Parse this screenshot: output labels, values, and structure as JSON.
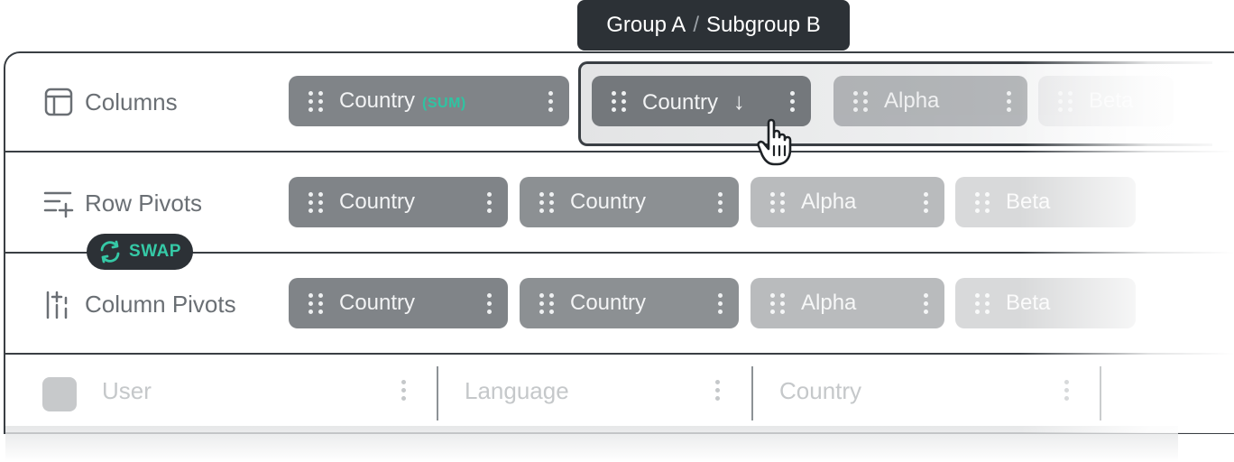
{
  "tooltip": {
    "group": "Group A",
    "separator": "/",
    "subgroup": "Subgroup B"
  },
  "rows": {
    "columns": {
      "label": "Columns",
      "icon": "table-columns-icon"
    },
    "row_pivots": {
      "label": "Row Pivots",
      "icon": "row-pivot-add-icon"
    },
    "column_pivots": {
      "label": "Column Pivots",
      "icon": "column-pivot-add-icon"
    }
  },
  "columns_pills": [
    {
      "label": "Country",
      "badge": "(SUM)"
    },
    {
      "label": "Country",
      "sort_glyph": "↓"
    },
    {
      "label": "Alpha"
    },
    {
      "label": "Beta"
    }
  ],
  "row_pivot_pills": [
    {
      "label": "Country"
    },
    {
      "label": "Country"
    },
    {
      "label": "Alpha"
    },
    {
      "label": "Beta"
    }
  ],
  "column_pivot_pills": [
    {
      "label": "Country"
    },
    {
      "label": "Country"
    },
    {
      "label": "Alpha"
    },
    {
      "label": "Beta"
    }
  ],
  "swap_button": {
    "label": "SWAP",
    "icon": "swap-icon"
  },
  "table_header": {
    "columns": [
      "User",
      "Language",
      "Country"
    ]
  },
  "colors": {
    "accent": "#2ec4a2",
    "pill": "#808488",
    "dark": "#2c3136"
  }
}
